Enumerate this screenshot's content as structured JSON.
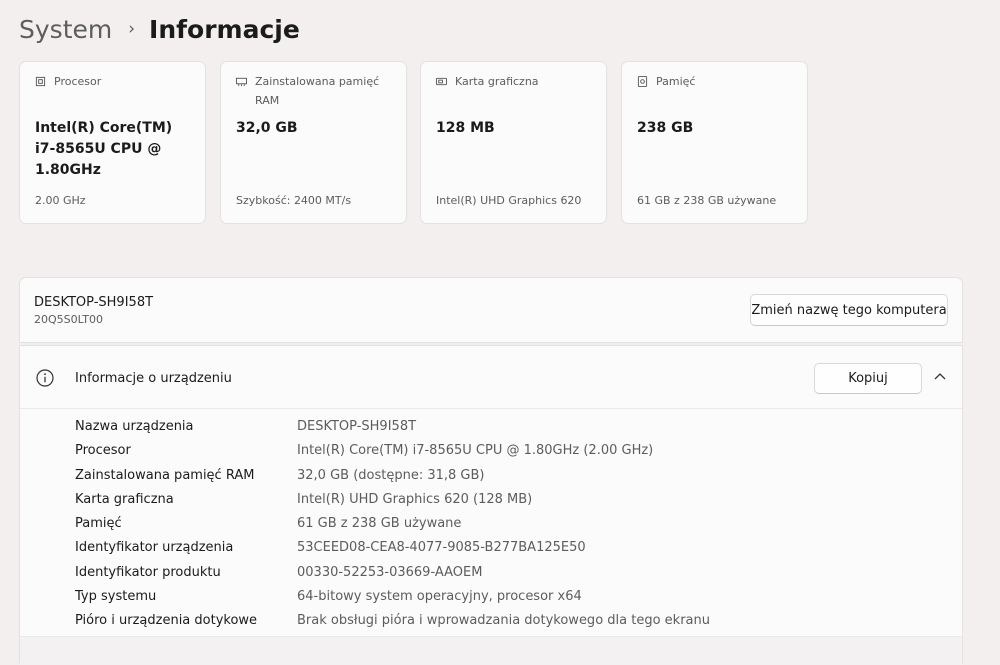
{
  "breadcrumb": {
    "parent": "System",
    "separator": "›",
    "current": "Informacje"
  },
  "cards": [
    {
      "icon": "processor-icon",
      "label": "Procesor",
      "value": "Intel(R) Core(TM) i7-8565U CPU @ 1.80GHz",
      "detail": "2.00 GHz"
    },
    {
      "icon": "ram-icon",
      "label": "Zainstalowana pamięć RAM",
      "value": "32,0 GB",
      "detail": "Szybkość: 2400 MT/s"
    },
    {
      "icon": "graphics-card-icon",
      "label": "Karta graficzna",
      "value": "128 MB",
      "detail": "Intel(R) UHD Graphics 620"
    },
    {
      "icon": "storage-icon",
      "label": "Pamięć",
      "value": "238 GB",
      "detail": "61 GB z 238 GB używane"
    }
  ],
  "device": {
    "name": "DESKTOP-SH9I58T",
    "model": "20Q5S0LT00",
    "rename_button": "Zmień nazwę tego komputera"
  },
  "device_info": {
    "icon": "info-icon",
    "title": "Informacje o urządzeniu",
    "copy_button": "Kopiuj",
    "rows": [
      {
        "label": "Nazwa urządzenia",
        "value": "DESKTOP-SH9I58T"
      },
      {
        "label": "Procesor",
        "value": "Intel(R) Core(TM) i7-8565U CPU @ 1.80GHz (2.00 GHz)"
      },
      {
        "label": "Zainstalowana pamięć RAM",
        "value": "32,0 GB (dostępne: 31,8 GB)"
      },
      {
        "label": "Karta graficzna",
        "value": "Intel(R) UHD Graphics 620 (128 MB)"
      },
      {
        "label": "Pamięć",
        "value": "61 GB z 238 GB używane"
      },
      {
        "label": "Identyfikator urządzenia",
        "value": "53CEED08-CEA8-4077-9085-B277BA125E50"
      },
      {
        "label": "Identyfikator produktu",
        "value": "00330-52253-03669-AAOEM"
      },
      {
        "label": "Typ systemu",
        "value": "64-bitowy system operacyjny, procesor x64"
      },
      {
        "label": "Pióro i urządzenia dotykowe",
        "value": "Brak obsługi pióra i wprowadzania dotykowego dla tego ekranu"
      }
    ]
  }
}
